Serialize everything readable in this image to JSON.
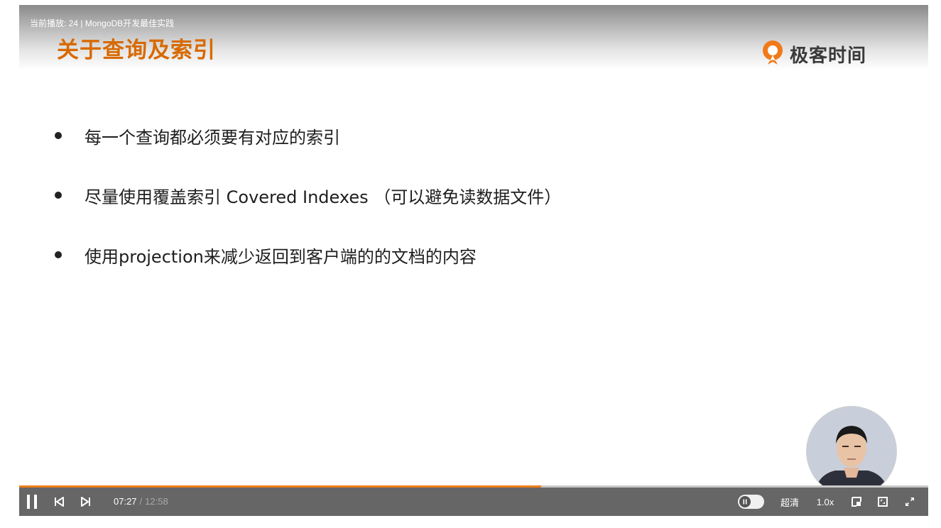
{
  "player": {
    "now_playing": "当前播放: 24 | MongoDB开发最佳实践",
    "progress_fraction": 0.574
  },
  "slide": {
    "title": "关于查询及索引",
    "logo_text": "极客时间",
    "bullets": [
      "每一个查询都必须要有对应的索引",
      "尽量使用覆盖索引 Covered Indexes （可以避免读数据文件）",
      "使用projection来减少返回到客户端的的文档的内容"
    ]
  },
  "controls": {
    "time_current": "07:27",
    "time_separator": "/",
    "time_total": "12:58",
    "quality_label": "超清",
    "speed_label": "1.0x"
  },
  "colors": {
    "title_orange": "#d76a00",
    "progress_orange": "#ef7e1a",
    "control_bar": "#666666"
  },
  "icons": {
    "pause": "pause-icon",
    "previous": "skip-previous-icon",
    "next": "skip-next-icon",
    "pip": "picture-in-picture-icon",
    "web_fullscreen": "web-fullscreen-icon",
    "fullscreen": "fullscreen-icon"
  }
}
